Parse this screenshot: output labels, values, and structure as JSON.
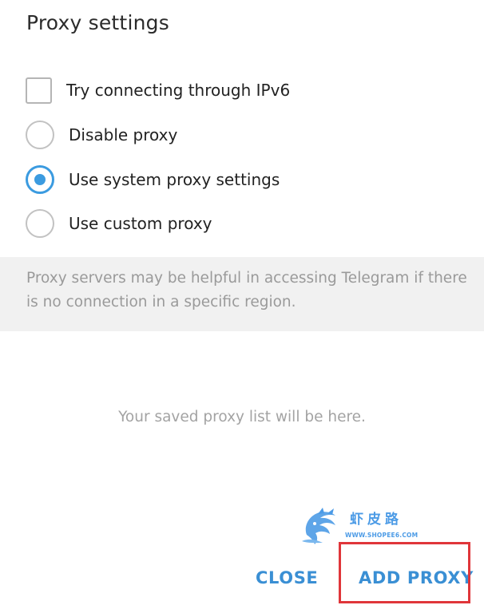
{
  "dialog": {
    "title": "Proxy settings"
  },
  "options": {
    "ipv6": {
      "label": "Try connecting through IPv6",
      "checked": false
    },
    "disable": {
      "label": "Disable proxy",
      "selected": false
    },
    "system": {
      "label": "Use system proxy settings",
      "selected": true
    },
    "custom": {
      "label": "Use custom proxy",
      "selected": false
    }
  },
  "info": {
    "text": "Proxy servers may be helpful in accessing Telegram if there is no connection in a specific region."
  },
  "empty_list": {
    "text": "Your saved proxy list will be here."
  },
  "watermark": {
    "chinese": "虾皮路",
    "url": "WWW.SHOPEE6.COM",
    "icon": "dragon-logo-icon"
  },
  "buttons": {
    "close": "CLOSE",
    "add_proxy": "ADD PROXY"
  },
  "colors": {
    "accent": "#3b9be0",
    "button_text": "#3a8fd4",
    "highlight": "#e0363a",
    "info_bg": "#f1f1f1"
  }
}
